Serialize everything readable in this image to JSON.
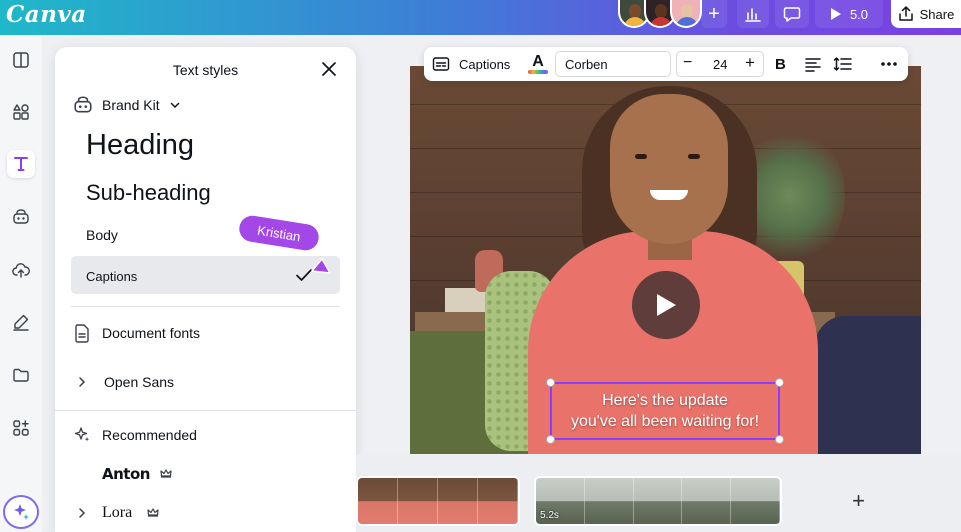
{
  "app": {
    "logo": "Canva"
  },
  "topbar": {
    "present_label": "5.0",
    "share_label": "Share"
  },
  "panel": {
    "title": "Text styles",
    "brand_kit_label": "Brand Kit",
    "styles": [
      {
        "label": "Heading"
      },
      {
        "label": "Sub-heading"
      },
      {
        "label": "Body"
      },
      {
        "label": "Captions",
        "selected": true
      }
    ],
    "document_fonts_label": "Document fonts",
    "document_fonts": [
      {
        "label": "Open Sans"
      }
    ],
    "recommended_label": "Recommended",
    "recommended_fonts": [
      {
        "label": "Anton",
        "premium": true
      },
      {
        "label": "Lora",
        "premium": true
      }
    ]
  },
  "collaborator_cursor": {
    "name": "Kristian",
    "color": "#a347e8"
  },
  "toolbar": {
    "captions_label": "Captions",
    "font_name": "Corben",
    "font_size": "24",
    "bold_label": "B"
  },
  "canvas": {
    "caption_lines": [
      "Here's the update",
      "you've all been waiting for!"
    ]
  },
  "timeline": {
    "clips": [
      {
        "frames": 4
      },
      {
        "frames": 5,
        "duration": "5.2s"
      }
    ]
  },
  "colors": {
    "accent": "#8b3dff",
    "topbar_gradient_start": "#1fb8c9",
    "topbar_gradient_end": "#7a3fe4"
  }
}
